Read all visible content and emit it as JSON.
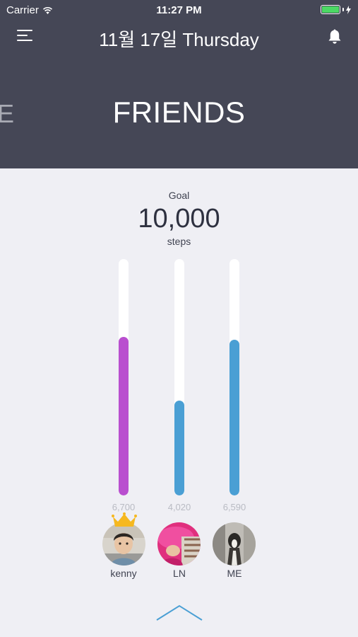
{
  "status_bar": {
    "carrier": "Carrier",
    "time": "11:27 PM",
    "battery_level": 1.0
  },
  "nav": {
    "title": "11월 17일 Thursday",
    "menu_icon": "hamburger-menu-icon",
    "bell_icon": "bell-icon"
  },
  "header": {
    "prev_section_fragment": "E",
    "section_title": "FRIENDS"
  },
  "goal": {
    "label": "Goal",
    "value": "10,000",
    "unit": "steps",
    "max_steps": 10000
  },
  "friends": [
    {
      "name": "kenny",
      "steps": 6700,
      "steps_label": "6,700",
      "color": "#b94fcf",
      "leader": true
    },
    {
      "name": "LN",
      "steps": 4020,
      "steps_label": "4,020",
      "color": "#4a9fd4",
      "leader": false
    },
    {
      "name": "ME",
      "steps": 6590,
      "steps_label": "6,590",
      "color": "#4a9fd4",
      "leader": false
    }
  ],
  "colors": {
    "header_bg": "#454756",
    "page_bg": "#efeff4",
    "track": "#ffffff",
    "crown": "#f6b81f",
    "chevron": "#4a9fd4"
  }
}
